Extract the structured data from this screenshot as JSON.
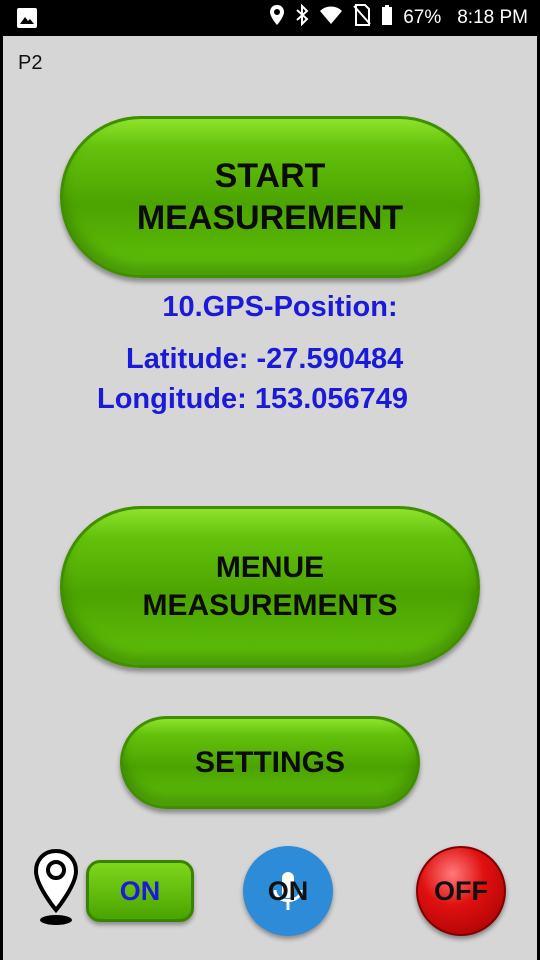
{
  "status_bar": {
    "battery": "67%",
    "time": "8:18 PM",
    "icons": [
      "image-icon",
      "location-icon",
      "bluetooth-icon",
      "wifi-icon",
      "no-sim-icon",
      "battery-icon"
    ]
  },
  "page": {
    "label": "P2"
  },
  "start_button": {
    "line1": "START",
    "line2": "MEASUREMENT"
  },
  "gps": {
    "title": "10.GPS-Position:",
    "latitude": "Latitude: -27.590484",
    "longitude": "Longitude: 153.056749"
  },
  "menue_button": {
    "line1": "MENUE",
    "line2": "MEASUREMENTS"
  },
  "settings_button": {
    "label": "SETTINGS"
  },
  "bottom": {
    "gps_toggle": "ON",
    "voice_toggle": "ON",
    "off_button": "OFF"
  },
  "colors": {
    "accent_text": "#1a1ad8",
    "button_green": "#5fc10a",
    "mic_blue": "#2d8bd8",
    "off_red": "#e01010"
  }
}
